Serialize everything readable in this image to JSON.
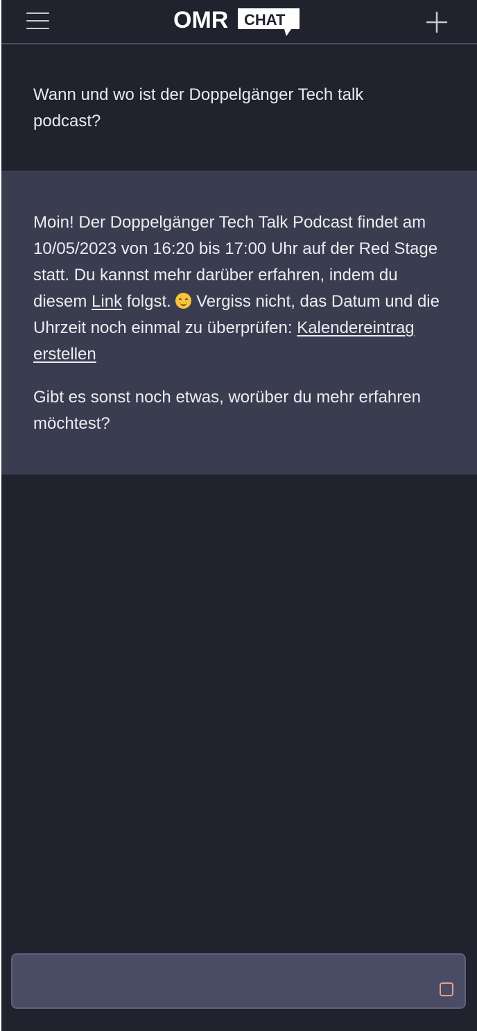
{
  "header": {
    "menu_icon": "hamburger-menu-icon",
    "logo": {
      "brand": "OMR",
      "badge": "CHAT"
    },
    "new_chat_icon": "plus-icon"
  },
  "conversation": {
    "user_message": "Wann und wo ist der Doppelgänger Tech talk podcast?",
    "assistant_message": {
      "p1_part1": "Moin! Der Doppelgänger Tech Talk Podcast findet am 10/05/2023 von 16:20 bis 17:00 Uhr auf der Red Stage statt. Du kannst mehr darüber erfahren, indem du diesem ",
      "link_label": "Link",
      "p1_part2": " folgst. ",
      "emoji": "smiling-face-emoji",
      "p1_part3": " Vergiss nicht, das Datum und die Uhrzeit noch einmal zu überprüfen: ",
      "calendar_link_label": "Kalendereintrag erstellen",
      "p2": "Gibt es sonst noch etwas, worüber du mehr erfahren möchtest?"
    }
  },
  "composer": {
    "value": "",
    "placeholder": "",
    "send_icon": "send-icon"
  },
  "colors": {
    "background": "#20222e",
    "assistant_bg": "#3a3c4f",
    "composer_bg": "#4a4c65",
    "text": "#ececf1",
    "send_icon": "#e8a08a"
  }
}
